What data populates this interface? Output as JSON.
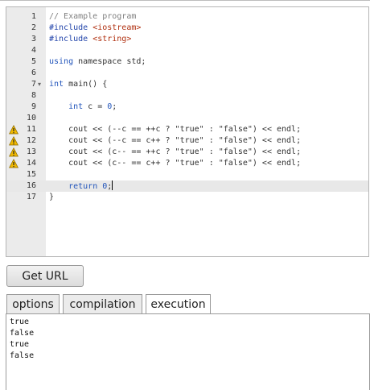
{
  "editor": {
    "lines": [
      {
        "num": "1",
        "fold": "",
        "warn": false,
        "parts": [
          {
            "t": "// Example program",
            "c": "#808080"
          }
        ]
      },
      {
        "num": "2",
        "fold": "",
        "warn": false,
        "parts": [
          {
            "t": "#include ",
            "c": "#2244aa"
          },
          {
            "t": "<iostream>",
            "c": "#b03010"
          }
        ]
      },
      {
        "num": "3",
        "fold": "",
        "warn": false,
        "parts": [
          {
            "t": "#include ",
            "c": "#2244aa"
          },
          {
            "t": "<string>",
            "c": "#b03010"
          }
        ]
      },
      {
        "num": "4",
        "fold": "",
        "warn": false,
        "parts": []
      },
      {
        "num": "5",
        "fold": "",
        "warn": false,
        "parts": [
          {
            "t": "using",
            "c": "#2255bb"
          },
          {
            "t": " namespace std;",
            "c": "#333333"
          }
        ]
      },
      {
        "num": "6",
        "fold": "",
        "warn": false,
        "parts": []
      },
      {
        "num": "7",
        "fold": "▾",
        "warn": false,
        "parts": [
          {
            "t": "int",
            "c": "#2255bb"
          },
          {
            "t": " main() {",
            "c": "#333333"
          }
        ]
      },
      {
        "num": "8",
        "fold": "",
        "warn": false,
        "parts": []
      },
      {
        "num": "9",
        "fold": "",
        "warn": false,
        "parts": [
          {
            "t": "    ",
            "c": "#333333"
          },
          {
            "t": "int",
            "c": "#2255bb"
          },
          {
            "t": " c = ",
            "c": "#333333"
          },
          {
            "t": "0",
            "c": "#2255bb"
          },
          {
            "t": ";",
            "c": "#333333"
          }
        ]
      },
      {
        "num": "10",
        "fold": "",
        "warn": false,
        "parts": []
      },
      {
        "num": "11",
        "fold": "",
        "warn": true,
        "parts": [
          {
            "t": "    cout << (--c == ++c ? ",
            "c": "#333333"
          },
          {
            "t": "\"true\"",
            "c": "#333333"
          },
          {
            "t": " : ",
            "c": "#333333"
          },
          {
            "t": "\"false\"",
            "c": "#333333"
          },
          {
            "t": ") << endl;",
            "c": "#333333"
          }
        ]
      },
      {
        "num": "12",
        "fold": "",
        "warn": true,
        "parts": [
          {
            "t": "    cout << (--c == c++ ? ",
            "c": "#333333"
          },
          {
            "t": "\"true\"",
            "c": "#333333"
          },
          {
            "t": " : ",
            "c": "#333333"
          },
          {
            "t": "\"false\"",
            "c": "#333333"
          },
          {
            "t": ") << endl;",
            "c": "#333333"
          }
        ]
      },
      {
        "num": "13",
        "fold": "",
        "warn": true,
        "parts": [
          {
            "t": "    cout << (c-- == ++c ? ",
            "c": "#333333"
          },
          {
            "t": "\"true\"",
            "c": "#333333"
          },
          {
            "t": " : ",
            "c": "#333333"
          },
          {
            "t": "\"false\"",
            "c": "#333333"
          },
          {
            "t": ") << endl;",
            "c": "#333333"
          }
        ]
      },
      {
        "num": "14",
        "fold": "",
        "warn": true,
        "parts": [
          {
            "t": "    cout << (c-- == c++ ? ",
            "c": "#333333"
          },
          {
            "t": "\"true\"",
            "c": "#333333"
          },
          {
            "t": " : ",
            "c": "#333333"
          },
          {
            "t": "\"false\"",
            "c": "#333333"
          },
          {
            "t": ") << endl;",
            "c": "#333333"
          }
        ]
      },
      {
        "num": "15",
        "fold": "",
        "warn": false,
        "parts": []
      },
      {
        "num": "16",
        "fold": "",
        "warn": false,
        "active": true,
        "parts": [
          {
            "t": "    ",
            "c": "#333333"
          },
          {
            "t": "return",
            "c": "#2255bb"
          },
          {
            "t": " ",
            "c": "#333333"
          },
          {
            "t": "0",
            "c": "#2255bb"
          },
          {
            "t": ";",
            "c": "#333333"
          }
        ]
      },
      {
        "num": "17",
        "fold": "",
        "warn": false,
        "parts": [
          {
            "t": "}",
            "c": "#333333"
          }
        ]
      }
    ]
  },
  "toolbar": {
    "get_url_label": "Get URL"
  },
  "tabs": [
    {
      "label": "options",
      "active": false
    },
    {
      "label": "compilation",
      "active": false
    },
    {
      "label": "execution",
      "active": true
    }
  ],
  "output": {
    "lines": [
      "true",
      "false",
      "true",
      "false"
    ]
  },
  "icons": {
    "warning": "warning-icon"
  },
  "colors": {
    "warning_fill": "#f0b800",
    "keyword": "#2255bb",
    "comment": "#808080",
    "include_path": "#b03010"
  }
}
